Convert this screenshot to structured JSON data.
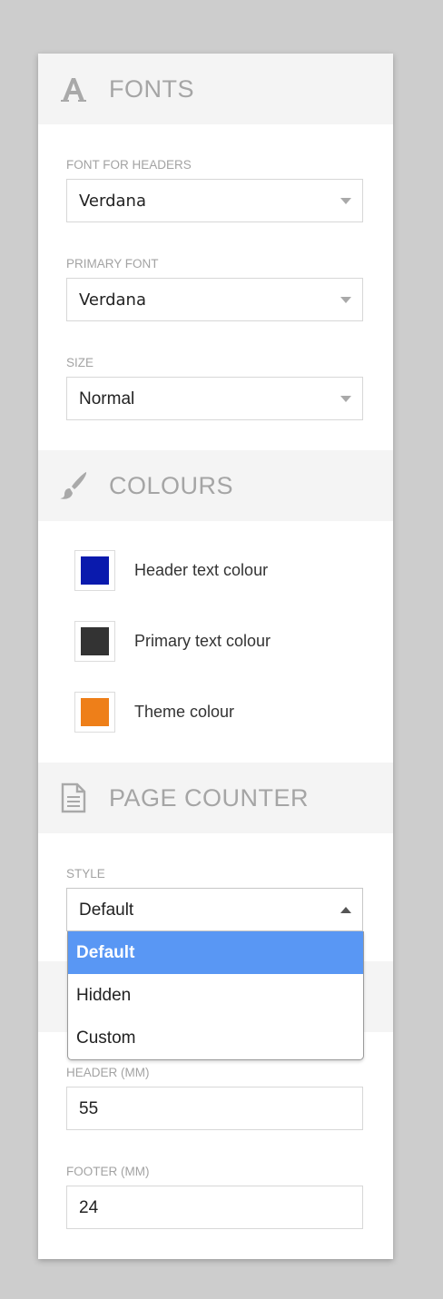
{
  "fonts": {
    "title": "FONTS",
    "icon": "font-letter-a-icon",
    "header_font": {
      "label": "FONT FOR HEADERS",
      "value": "Verdana"
    },
    "primary_font": {
      "label": "PRIMARY FONT",
      "value": "Verdana"
    },
    "size": {
      "label": "SIZE",
      "value": "Normal"
    }
  },
  "colours": {
    "title": "COLOURS",
    "icon": "paintbrush-icon",
    "items": [
      {
        "label": "Header text colour",
        "color": "#0a1aad"
      },
      {
        "label": "Primary text colour",
        "color": "#333333"
      },
      {
        "label": "Theme colour",
        "color": "#ee7f19"
      }
    ]
  },
  "page_counter": {
    "title": "PAGE COUNTER",
    "icon": "document-icon",
    "style": {
      "label": "STYLE",
      "value": "Default",
      "options": [
        "Default",
        "Hidden",
        "Custom"
      ],
      "highlighted": "Default"
    }
  },
  "margins": {
    "header": {
      "label": "HEADER (MM)",
      "value": "55"
    },
    "footer": {
      "label": "FOOTER (MM)",
      "value": "24"
    }
  },
  "colors": {
    "background": "#cdcdcd",
    "panel": "#ffffff",
    "section_header_bg": "#f4f4f4",
    "section_title": "#a5a5a5",
    "dropdown_highlight": "#5997f4"
  }
}
